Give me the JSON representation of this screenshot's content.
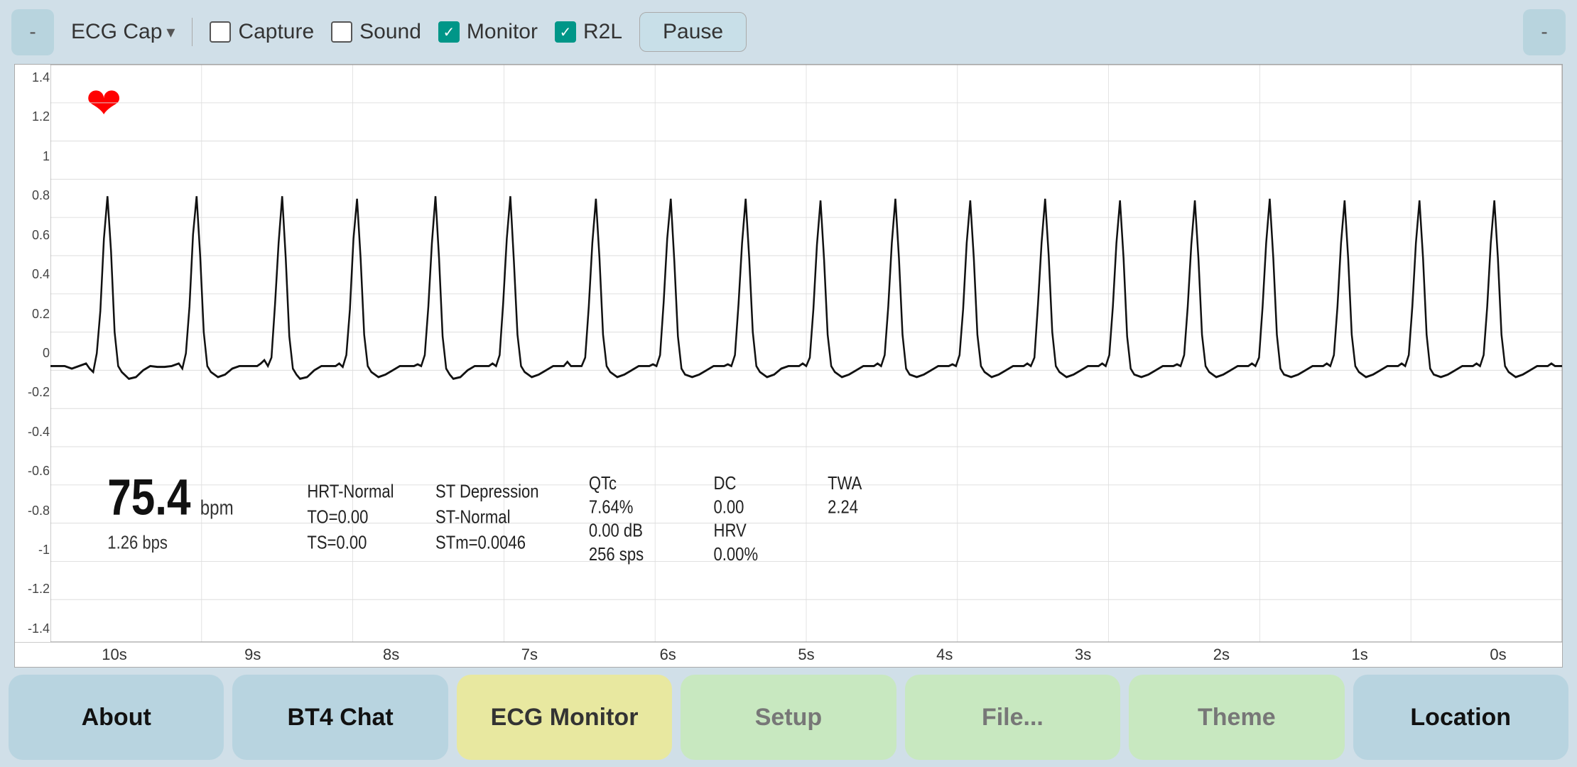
{
  "toolbar": {
    "left_btn_label": "-",
    "right_btn_label": "-",
    "title": "ECG Cap",
    "dropdown_arrow": "▾",
    "capture_label": "Capture",
    "capture_checked": false,
    "sound_label": "Sound",
    "sound_checked": false,
    "monitor_label": "Monitor",
    "monitor_checked": true,
    "r2l_label": "R2L",
    "r2l_checked": true,
    "pause_label": "Pause"
  },
  "chart": {
    "y_labels": [
      "1.4",
      "1.2",
      "1",
      "0.8",
      "0.6",
      "0.4",
      "0.2",
      "0",
      "-0.2",
      "-0.4",
      "-0.6",
      "-0.8",
      "-1",
      "-1.2",
      "-1.4"
    ],
    "time_labels": [
      "10s",
      "9s",
      "8s",
      "7s",
      "6s",
      "5s",
      "4s",
      "3s",
      "2s",
      "1s",
      "0s"
    ],
    "heart_icon": "❤",
    "stats": {
      "bpm": "75.4",
      "bpm_unit": "bpm",
      "bps": "1.26 bps",
      "hrt": "HRT-Normal",
      "to": "TO=0.00",
      "ts": "TS=0.00",
      "st_depression": "ST Depression",
      "st_normal": "ST-Normal",
      "stm": "STm=0.0046",
      "qtc_label": "QTc",
      "qtc_val": "7.64%",
      "qtc_db": "0.00 dB",
      "sps": "256 sps",
      "dc_label": "DC",
      "dc_val": "0.00",
      "hrv_label": "HRV",
      "hrv_val": "0.00%",
      "twa_label": "TWA",
      "twa_val": "2.24"
    }
  },
  "tabs": [
    {
      "id": "about",
      "label": "About",
      "style": "about"
    },
    {
      "id": "bt4chat",
      "label": "BT4 Chat",
      "style": "bt4chat"
    },
    {
      "id": "ecgmonitor",
      "label": "ECG Monitor",
      "style": "ecgmonitor"
    },
    {
      "id": "setup",
      "label": "Setup",
      "style": "setup"
    },
    {
      "id": "file",
      "label": "File...",
      "style": "file"
    },
    {
      "id": "theme",
      "label": "Theme",
      "style": "theme"
    },
    {
      "id": "location",
      "label": "Location",
      "style": "location"
    }
  ]
}
